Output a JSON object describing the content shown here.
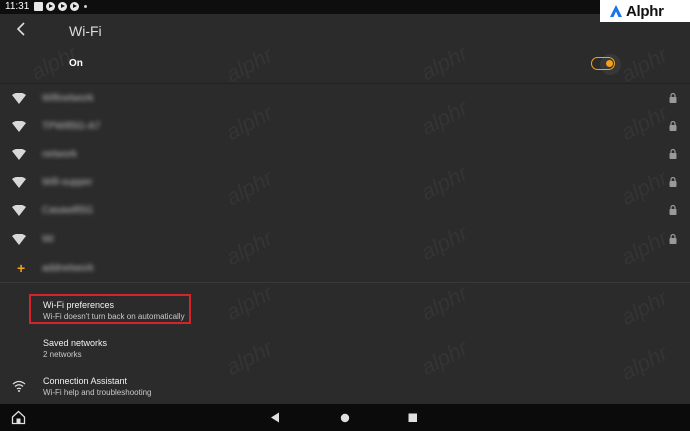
{
  "status_bar": {
    "time": "11:31"
  },
  "brand": {
    "name": "Alphr",
    "color": "#1a73e8"
  },
  "header": {
    "title": "Wi-Fi"
  },
  "wifi_toggle": {
    "label": "On",
    "state": "on",
    "accent": "#f3a21b"
  },
  "networks": [
    {
      "name": "Wifinetwork"
    },
    {
      "name": "TPWifi5G-A7"
    },
    {
      "name": "network"
    },
    {
      "name": "Wifi-supper"
    },
    {
      "name": "Casawifi5G"
    },
    {
      "name": "Wi"
    }
  ],
  "add_network": {
    "name": "addnetwork"
  },
  "preferences": [
    {
      "title": "Wi-Fi preferences",
      "subtitle": "Wi-Fi doesn't turn back on automatically",
      "icon": ""
    },
    {
      "title": "Saved networks",
      "subtitle": "2 networks",
      "icon": ""
    },
    {
      "title": "Connection Assistant",
      "subtitle": "Wi-Fi help and troubleshooting",
      "icon": "wifi-assistant-icon"
    }
  ],
  "highlight_color": "#d3242c"
}
